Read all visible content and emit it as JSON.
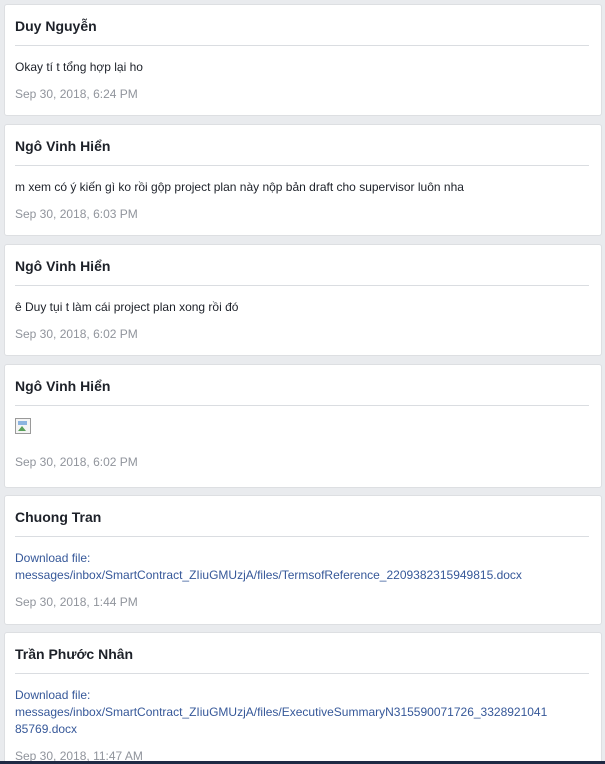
{
  "messages": [
    {
      "author": "Duy Nguyễn",
      "text": "Okay tí t tổng hợp lại ho",
      "timestamp": "Sep 30, 2018, 6:24 PM"
    },
    {
      "author": "Ngô Vinh Hiển",
      "text": "m xem có ý kiến gì ko rồi gộp project plan này nộp bản draft cho supervisor luôn nha",
      "timestamp": "Sep 30, 2018, 6:03 PM"
    },
    {
      "author": "Ngô Vinh Hiển",
      "text": "ê Duy tụi t làm cái project plan xong rồi đó",
      "timestamp": "Sep 30, 2018, 6:02 PM"
    },
    {
      "author": "Ngô Vinh Hiển",
      "image_icon": "broken-image-icon",
      "timestamp": "Sep 30, 2018, 6:02 PM"
    },
    {
      "author": "Chuong Tran",
      "link_line1": "Download file:",
      "link_line2": "messages/inbox/SmartContract_ZIiuGMUzjA/files/TermsofReference_2209382315949815.docx",
      "timestamp": "Sep 30, 2018, 1:44 PM"
    },
    {
      "author": "Trần Phước Nhân",
      "link_line1": "Download file:",
      "link_line2": "messages/inbox/SmartContract_ZIiuGMUzjA/files/ExecutiveSummaryN315590071726_3328921041",
      "link_line3": "85769.docx",
      "timestamp": "Sep 30, 2018, 11:47 AM"
    }
  ],
  "colors": {
    "background": "#e9ebee",
    "author": "#1d2129",
    "link": "#365899",
    "timestamp": "#90949c"
  }
}
